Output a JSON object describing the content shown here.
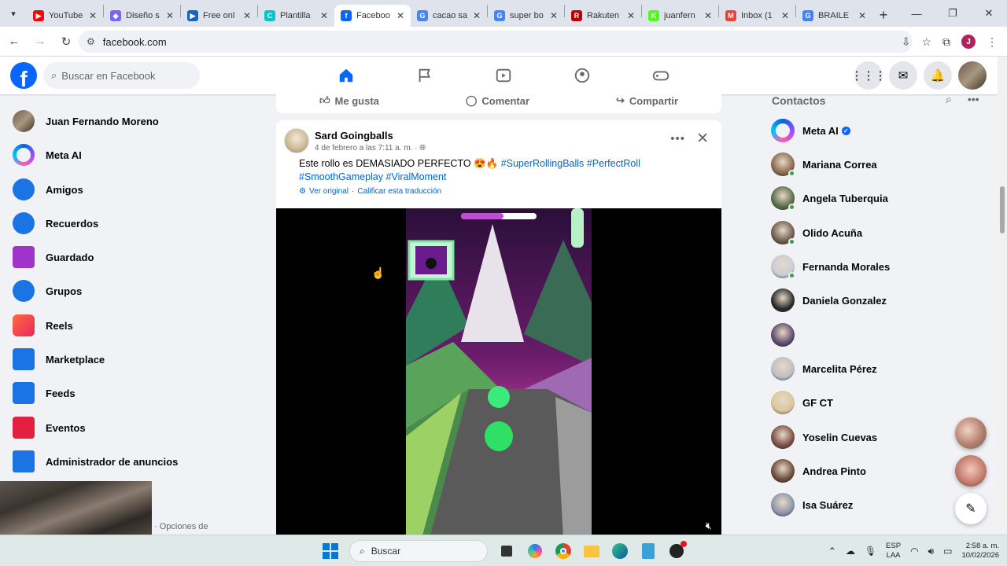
{
  "browser": {
    "tabs": [
      {
        "title": "YouTube",
        "color": "#ff0000",
        "glyph": "▶"
      },
      {
        "title": "Diseño s",
        "color": "#7b61ff",
        "glyph": "◆"
      },
      {
        "title": "Free onl",
        "color": "#1565c0",
        "glyph": "▶"
      },
      {
        "title": "Plantilla",
        "color": "#00c4cc",
        "glyph": "C"
      },
      {
        "title": "Faceboo",
        "color": "#0866ff",
        "glyph": "f"
      },
      {
        "title": "cacao sa",
        "color": "#4285f4",
        "glyph": "G"
      },
      {
        "title": "super bo",
        "color": "#4285f4",
        "glyph": "G"
      },
      {
        "title": "Rakuten",
        "color": "#bf0000",
        "glyph": "R"
      },
      {
        "title": "juanfern",
        "color": "#53fc18",
        "glyph": "K"
      },
      {
        "title": "Inbox (1",
        "color": "#ea4335",
        "glyph": "M"
      },
      {
        "title": "BRAILE",
        "color": "#4285f4",
        "glyph": "G"
      }
    ],
    "active_tab": 4,
    "url": "facebook.com",
    "profile_initial": "J"
  },
  "fb": {
    "search_placeholder": "Buscar en Facebook",
    "left_menu": [
      {
        "label": "Juan Fernando Moreno",
        "icon": "profile-avatar-icon"
      },
      {
        "label": "Meta AI",
        "icon": "meta-ai-icon"
      },
      {
        "label": "Amigos",
        "icon": "friends-icon"
      },
      {
        "label": "Recuerdos",
        "icon": "memories-icon"
      },
      {
        "label": "Guardado",
        "icon": "saved-icon"
      },
      {
        "label": "Grupos",
        "icon": "groups-icon"
      },
      {
        "label": "Reels",
        "icon": "reels-icon"
      },
      {
        "label": "Marketplace",
        "icon": "marketplace-icon"
      },
      {
        "label": "Feeds",
        "icon": "feeds-icon"
      },
      {
        "label": "Eventos",
        "icon": "events-icon"
      },
      {
        "label": "Administrador de anuncios",
        "icon": "ads-manager-icon"
      }
    ],
    "footer_partial": "· Opciones de",
    "prev_post_actions": {
      "like": "Me gusta",
      "comment": "Comentar",
      "share": "Compartir"
    },
    "post": {
      "author": "Sard Goingballs",
      "date": "4 de febrero a las 7:11 a. m. ·",
      "text": "Este rollo es DEMASIADO PERFECTO 😍🔥",
      "hashtags": [
        "#SuperRollingBalls",
        "#PerfectRoll",
        "#SmoothGameplay",
        "#ViralMoment"
      ],
      "see_original": "Ver original",
      "rate_translation": "Calificar esta traducción"
    },
    "contacts_title": "Contactos",
    "contacts": [
      {
        "name": "Meta AI",
        "verified": true,
        "online": false,
        "color": "#7b5cff"
      },
      {
        "name": "Mariana Correa",
        "online": true,
        "color": "#8a6a4e"
      },
      {
        "name": "Angela Tuberquia",
        "online": true,
        "color": "#5a6b4a"
      },
      {
        "name": "Olido Acuña",
        "online": true,
        "color": "#6e5b4f"
      },
      {
        "name": "Fernanda Morales",
        "online": true,
        "color": "#c9ced6"
      },
      {
        "name": "Daniela Gonzalez",
        "online": false,
        "color": "#2a2a2a"
      },
      {
        "name": "",
        "online": false,
        "color": "#5d4a6a"
      },
      {
        "name": "Marcelita Pérez",
        "online": false,
        "color": "#bcc0c4"
      },
      {
        "name": "GF CT",
        "online": false,
        "color": "#d9c89a"
      },
      {
        "name": "Yoselin Cuevas",
        "online": false,
        "color": "#7a4e44"
      },
      {
        "name": "Andrea Pinto",
        "online": false,
        "color": "#6b4a3a"
      },
      {
        "name": "Isa Suárez",
        "online": false,
        "color": "#8b96a8"
      }
    ]
  },
  "taskbar": {
    "search_placeholder": "Buscar",
    "lang_top": "ESP",
    "lang_bottom": "LAA",
    "time": "2:58 a. m.",
    "date": "10/02/2026"
  }
}
